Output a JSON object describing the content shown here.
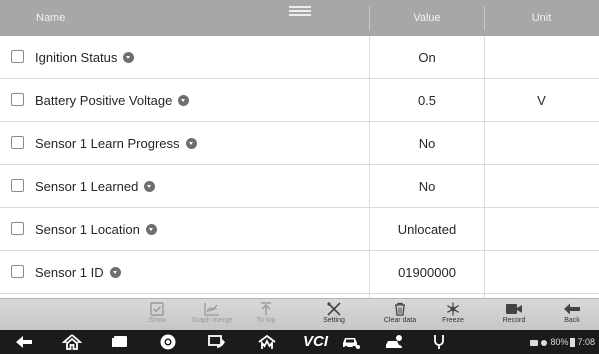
{
  "table": {
    "headers": {
      "name": "Name",
      "value": "Value",
      "unit": "Unit"
    },
    "rows": [
      {
        "name": "Ignition Status",
        "value": "On",
        "unit": ""
      },
      {
        "name": "Battery Positive Voltage",
        "value": "0.5",
        "unit": "V"
      },
      {
        "name": "Sensor 1 Learn Progress",
        "value": "No",
        "unit": ""
      },
      {
        "name": "Sensor 1 Learned",
        "value": "No",
        "unit": ""
      },
      {
        "name": "Sensor 1 Location",
        "value": "Unlocated",
        "unit": ""
      },
      {
        "name": "Sensor 1 ID",
        "value": "01900000",
        "unit": ""
      },
      {
        "name": "",
        "value": "",
        "unit": ""
      }
    ]
  },
  "toolbar": {
    "show": "Show",
    "graph_merge": "Graph merge",
    "to_top": "To top",
    "setting": "Setting",
    "clear_data": "Clear data",
    "freeze": "Freeze",
    "record": "Record",
    "back": "Back"
  },
  "navbar": {
    "vci_label": "VCI",
    "battery": "80%",
    "time": "7:08"
  }
}
